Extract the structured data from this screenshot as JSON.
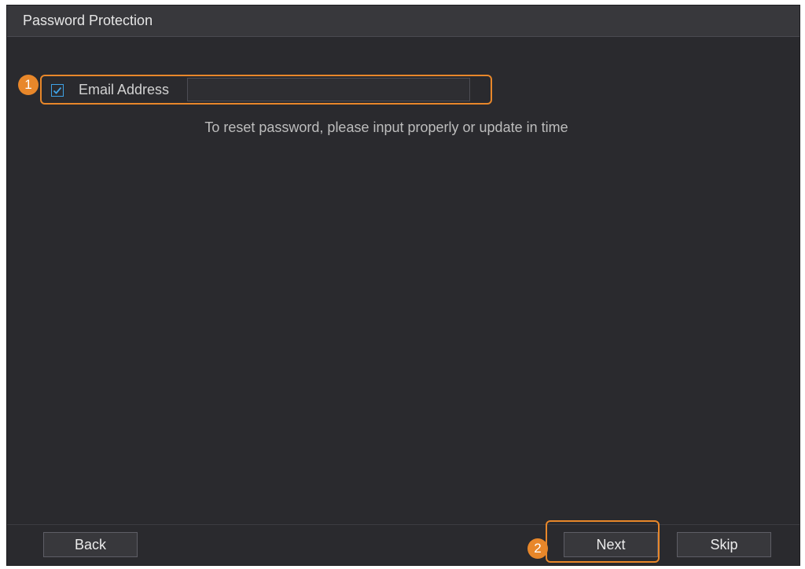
{
  "dialog": {
    "title": "Password Protection"
  },
  "form": {
    "email_checkbox_checked": true,
    "email_label": "Email Address",
    "email_value": "",
    "hint": "To reset password, please input properly or update in time"
  },
  "annotations": {
    "marker_1": "1",
    "marker_2": "2"
  },
  "footer": {
    "back_label": "Back",
    "next_label": "Next",
    "skip_label": "Skip"
  },
  "colors": {
    "background": "#2a2a2e",
    "titlebar": "#38383c",
    "accent_highlight": "#e8872a",
    "checkbox_accent": "#3ea2e6",
    "text": "#d2d2d2"
  },
  "icons": {
    "checkbox": "checkmark-icon"
  }
}
